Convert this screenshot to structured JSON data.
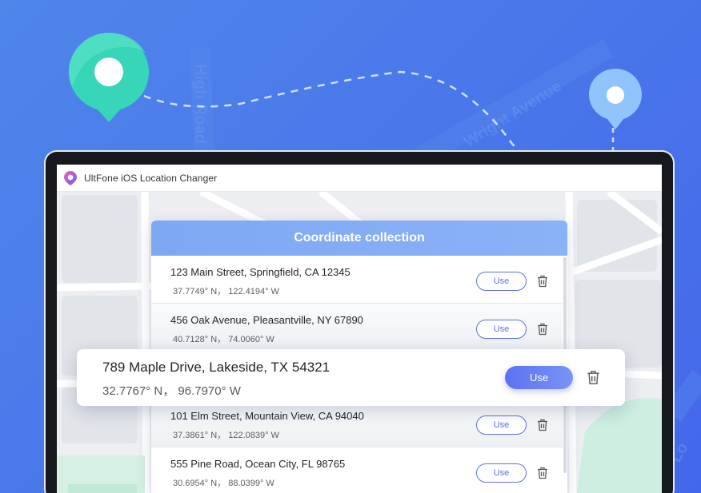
{
  "app": {
    "title": "UltFone iOS Location Changer"
  },
  "background": {
    "street_labels": [
      "High Road",
      "Wright Avenue",
      "Lo"
    ]
  },
  "dialog": {
    "title": "Coordinate collection",
    "use_label": "Use",
    "rows": [
      {
        "address": "123 Main Street, Springfield, CA 12345",
        "coords": "37.7749° N， 122.4194° W"
      },
      {
        "address": "456 Oak Avenue, Pleasantville, NY 67890",
        "coords": "40.7128° N， 74.0060° W"
      },
      {
        "address": "101 Elm Street, Mountain View, CA 94040",
        "coords": "37.3861° N， 122.0839° W"
      },
      {
        "address": "555 Pine Road, Ocean City, FL 98765",
        "coords": "30.6954° N， 88.0399° W"
      }
    ]
  },
  "highlight": {
    "address": "789 Maple Drive, Lakeside, TX 54321",
    "coords": "32.7767° N， 96.7970° W",
    "use_label": "Use"
  },
  "colors": {
    "background": "#4a78ea",
    "accent": "#5b6ff2",
    "header": "#86aef6",
    "pin_green": "#35d3b6",
    "pin_blue": "#8ec2f9"
  }
}
